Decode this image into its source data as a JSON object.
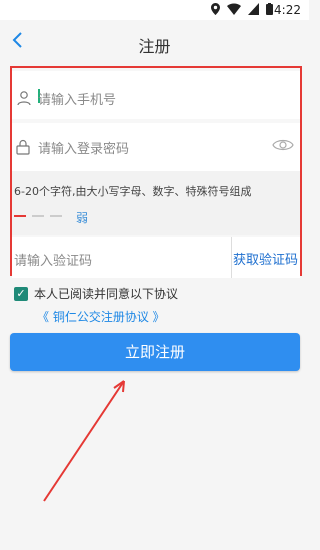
{
  "status_bar": {
    "time": "4:22"
  },
  "header": {
    "back_icon": "chevron-left-icon",
    "title": "注册"
  },
  "form": {
    "phone_placeholder": "请输入手机号",
    "password_placeholder": "请输入登录密码",
    "password_hint": "6-20个字符,由大小写字母、数字、特殊符号组成",
    "strength_label": "弱",
    "code_placeholder": "请输入验证码",
    "get_code_label": "获取验证码"
  },
  "agreement": {
    "text": "本人已阅读并同意以下协议",
    "protocol_link": "《 铜仁公交注册协议 》"
  },
  "register_button": "立即注册",
  "colors": {
    "accent_blue": "#2f8ef0",
    "annotation_red": "#e53935",
    "checkbox_green": "#1f8a78"
  }
}
